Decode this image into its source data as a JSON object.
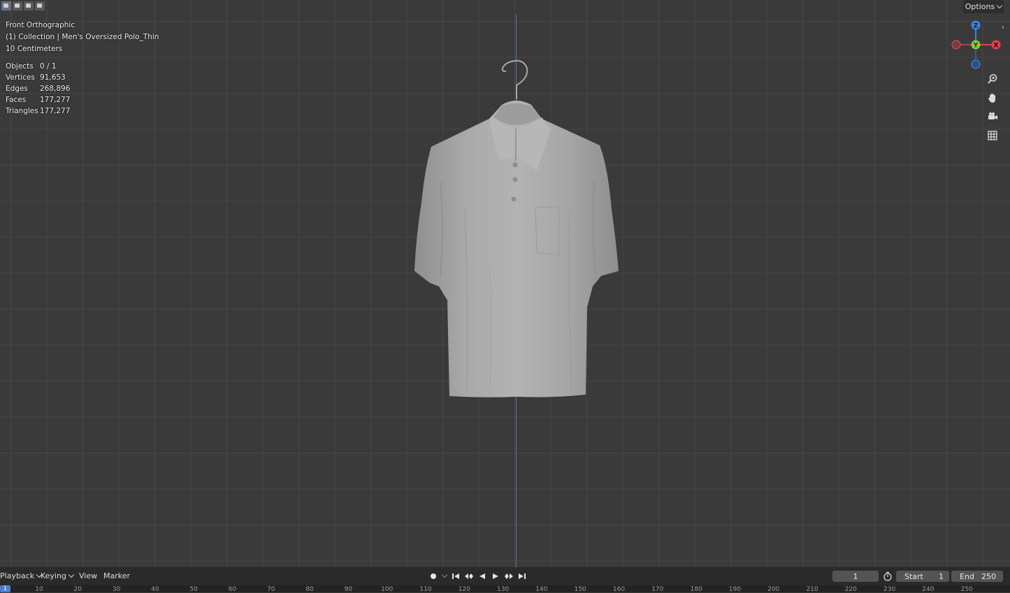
{
  "viewport": {
    "view_name": "Front Orthographic",
    "collection_label": "(1) Collection | Men's Oversized Polo_Thin",
    "grid_scale": "10 Centimeters",
    "stats": [
      {
        "label": "Objects",
        "value": "0 / 1"
      },
      {
        "label": "Vertices",
        "value": "91,653"
      },
      {
        "label": "Edges",
        "value": "268,896"
      },
      {
        "label": "Faces",
        "value": "177,277"
      },
      {
        "label": "Triangles",
        "value": "177,277"
      }
    ],
    "options_label": "Options",
    "gizmo": {
      "z": "Z",
      "y": "Y",
      "x": "X"
    },
    "colors": {
      "x_axis": "#e0424f",
      "y_axis": "#8cc63f",
      "z_axis": "#3d85d9",
      "grid_z_line": "#4f77b8"
    }
  },
  "timeline": {
    "menus": [
      {
        "label": "Playback"
      },
      {
        "label": "Keying"
      },
      {
        "label": "View"
      },
      {
        "label": "Marker"
      }
    ],
    "current_frame": "1",
    "start_label": "Start",
    "start_value": "1",
    "end_label": "End",
    "end_value": "250",
    "ruler_current": "1",
    "ruler_ticks": [
      "10",
      "20",
      "30",
      "40",
      "50",
      "60",
      "70",
      "80",
      "90",
      "100",
      "110",
      "120",
      "130",
      "140",
      "150",
      "160",
      "170",
      "180",
      "190",
      "200",
      "210",
      "220",
      "230",
      "240",
      "250"
    ]
  }
}
